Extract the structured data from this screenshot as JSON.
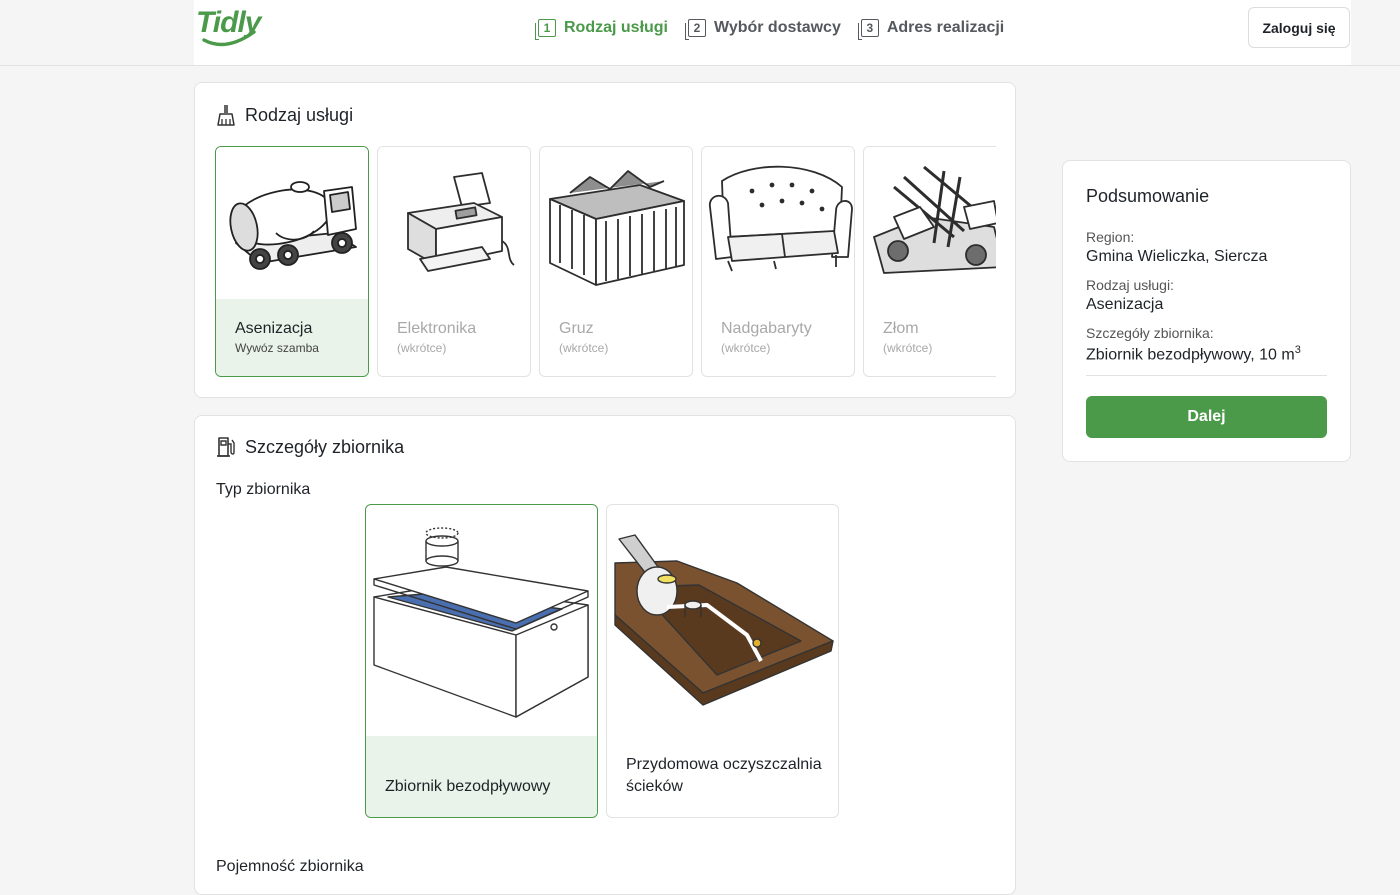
{
  "brand": {
    "logo_text": "Tidly",
    "accent_color": "#4a9a4a"
  },
  "header": {
    "steps": [
      {
        "num": "1",
        "label": "Rodzaj usługi",
        "active": true
      },
      {
        "num": "2",
        "label": "Wybór dostawcy",
        "active": false
      },
      {
        "num": "3",
        "label": "Adres realizacji",
        "active": false
      }
    ],
    "login_label": "Zaloguj się"
  },
  "service_section": {
    "title": "Rodzaj usługi",
    "icon": "broom-icon",
    "items": [
      {
        "name": "Asenizacja",
        "sub": "Wywóz szamba",
        "selected": true,
        "icon": "septic-truck-icon"
      },
      {
        "name": "Elektronika",
        "sub": "(wkrótce)",
        "selected": false,
        "icon": "printer-icon"
      },
      {
        "name": "Gruz",
        "sub": "(wkrótce)",
        "selected": false,
        "icon": "rubble-container-icon"
      },
      {
        "name": "Nadgabaryty",
        "sub": "(wkrótce)",
        "selected": false,
        "icon": "sofa-icon"
      },
      {
        "name": "Złom",
        "sub": "(wkrótce)",
        "selected": false,
        "icon": "scrap-metal-icon"
      }
    ]
  },
  "tank_section": {
    "title": "Szczegóły zbiornika",
    "icon": "fuel-tank-icon",
    "type_label": "Typ zbiornika",
    "types": [
      {
        "name": "Zbiornik bezodpływowy",
        "selected": true,
        "icon": "septic-tank-icon"
      },
      {
        "name": "Przydomowa oczyszczalnia ścieków",
        "selected": false,
        "icon": "treatment-plant-icon"
      }
    ],
    "capacity_label": "Pojemność zbiornika"
  },
  "summary": {
    "title": "Podsumowanie",
    "rows": [
      {
        "label": "Region:",
        "value": "Gmina Wieliczka, Siercza"
      },
      {
        "label": "Rodzaj usługi:",
        "value": "Asenizacja"
      },
      {
        "label": "Szczegóły zbiornika:",
        "value": "Zbiornik bezodpływowy, 10 m",
        "value_sup": "3"
      }
    ],
    "next_label": "Dalej"
  }
}
